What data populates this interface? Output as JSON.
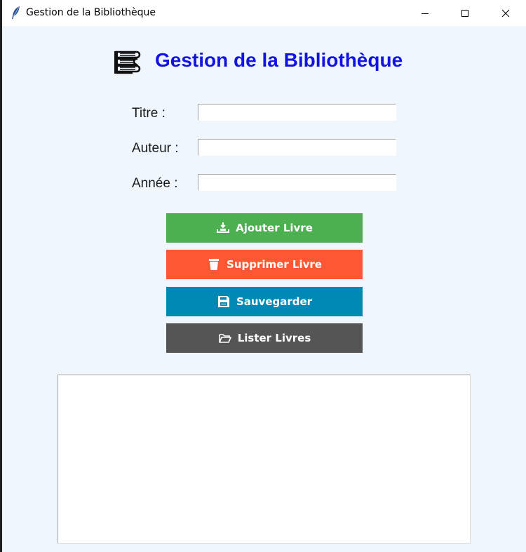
{
  "window": {
    "title": "Gestion de la Bibliothèque"
  },
  "header": {
    "title": "Gestion de la Bibliothèque",
    "icon": "books-icon",
    "title_color": "#1212e6"
  },
  "form": {
    "fields": [
      {
        "label": "Titre :",
        "value": ""
      },
      {
        "label": "Auteur :",
        "value": ""
      },
      {
        "label": "Année :",
        "value": ""
      }
    ]
  },
  "buttons": {
    "add": {
      "label": "Ajouter Livre",
      "icon": "add-book-icon",
      "color": "#4caf50"
    },
    "delete": {
      "label": "Supprimer Livre",
      "icon": "trash-icon",
      "color": "#ff5733"
    },
    "save": {
      "label": "Sauvegarder",
      "icon": "floppy-disk-icon",
      "color": "#0089b5"
    },
    "list": {
      "label": "Lister Livres",
      "icon": "open-folder-icon",
      "color": "#555555"
    }
  },
  "book_list": {
    "items": []
  }
}
